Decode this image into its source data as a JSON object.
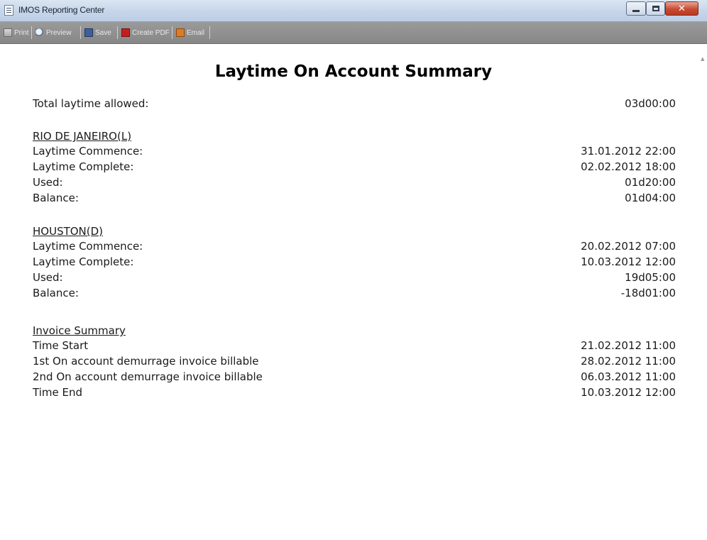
{
  "window": {
    "title": "IMOS Reporting Center",
    "controls": [
      "minimize-icon",
      "maximize-icon",
      "close-icon"
    ]
  },
  "toolbar": {
    "print_label": "Print",
    "preview_label": "Preview",
    "save_label": "Save",
    "create_pdf_label": "Create PDF",
    "email_label": "Email"
  },
  "report": {
    "title": "Laytime On Account Summary",
    "total_laytime": {
      "label": "Total laytime allowed:",
      "value": "03d00:00"
    },
    "rio": {
      "heading": "RIO DE JANEIRO(L)",
      "rows": [
        {
          "label": "Laytime Commence:",
          "value": "31.01.2012 22:00"
        },
        {
          "label": "Laytime Complete:",
          "value": "02.02.2012 18:00"
        },
        {
          "label": "Used:",
          "value": "01d20:00"
        },
        {
          "label": "Balance:",
          "value": "01d04:00"
        }
      ]
    },
    "houston": {
      "heading": "HOUSTON(D)",
      "rows": [
        {
          "label": "Laytime Commence:",
          "value": "20.02.2012 07:00"
        },
        {
          "label": "Laytime Complete:",
          "value": "10.03.2012 12:00"
        },
        {
          "label": "Used:",
          "value": "19d05:00"
        },
        {
          "label": "Balance:",
          "value": "-18d01:00"
        }
      ]
    },
    "invoice": {
      "heading": "Invoice Summary",
      "rows": [
        {
          "label": "Time Start",
          "value": "21.02.2012 11:00"
        },
        {
          "label": "1st On account demurrage invoice billable",
          "value": "28.02.2012 11:00"
        },
        {
          "label": "2nd On account demurrage invoice billable",
          "value": "06.03.2012 11:00"
        },
        {
          "label": "Time End",
          "value": "10.03.2012 12:00"
        }
      ]
    }
  },
  "colors": {
    "titlebar": "#c7d6ea",
    "toolbar": "#8f8f8f",
    "close_button": "#c94a33"
  }
}
